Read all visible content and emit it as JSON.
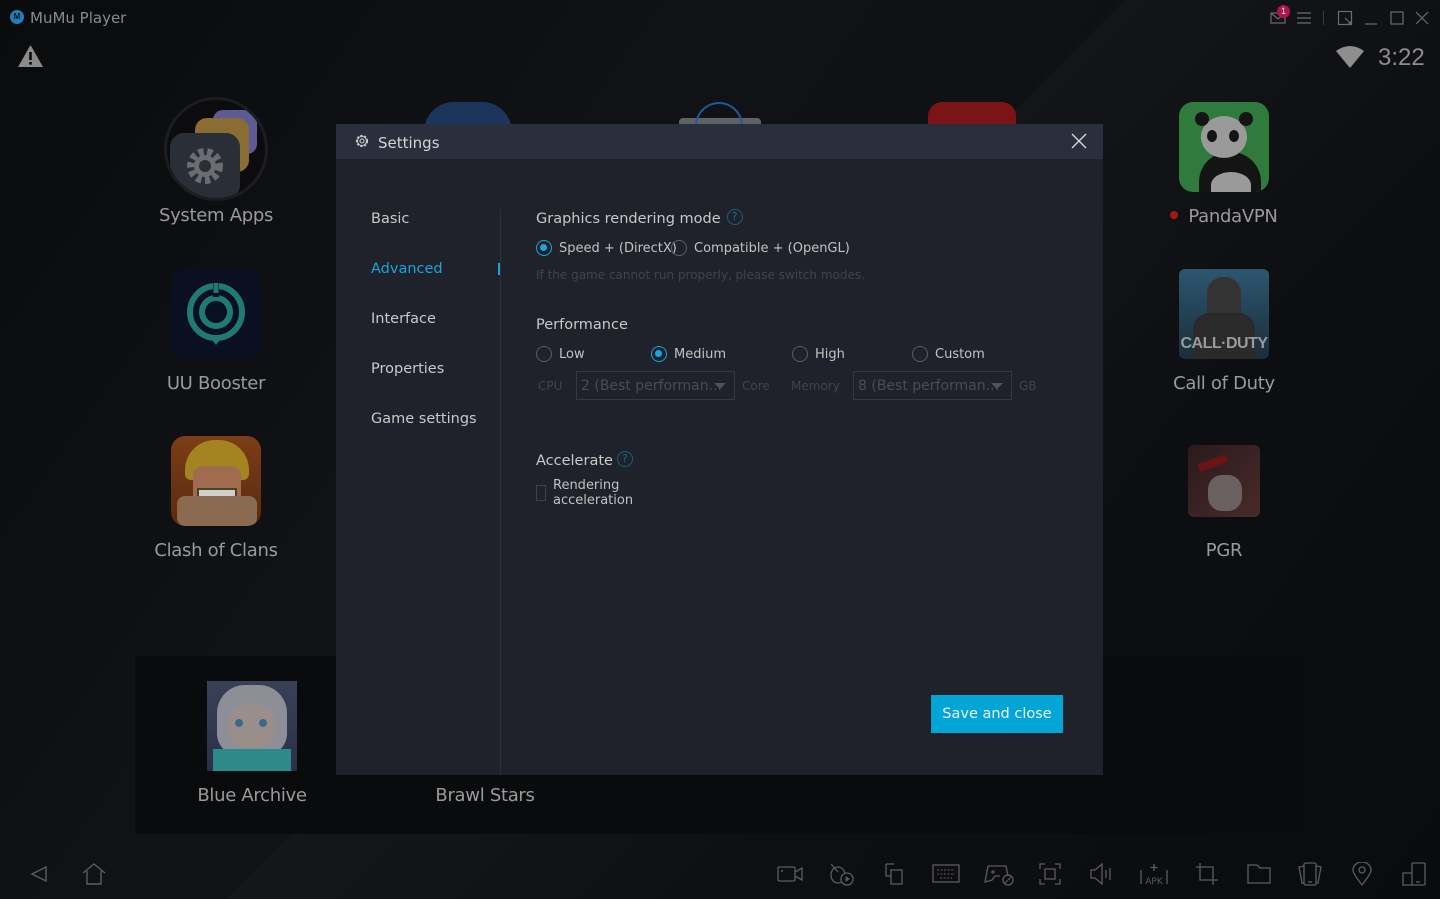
{
  "window": {
    "title": "MuMu Player",
    "notification_count": "1",
    "controls": [
      "mail-icon",
      "menu-icon",
      "resize-icon",
      "minimize-icon",
      "maximize-icon",
      "close-icon"
    ]
  },
  "statusbar": {
    "time": "3:22",
    "icons": [
      "warning-icon",
      "wifi-icon"
    ]
  },
  "desktop": {
    "apps_left": [
      {
        "label": "System Apps"
      },
      {
        "label": "UU Booster"
      },
      {
        "label": "Clash of Clans"
      }
    ],
    "apps_right": [
      {
        "label": "PandaVPN",
        "new_indicator": true
      },
      {
        "label": "Call of Duty"
      },
      {
        "label": "PGR"
      }
    ],
    "dock_apps": [
      {
        "label": "Blue Archive"
      },
      {
        "label": "Brawl Stars"
      }
    ]
  },
  "settings": {
    "title": "Settings",
    "nav": [
      {
        "label": "Basic",
        "active": false
      },
      {
        "label": "Advanced",
        "active": true
      },
      {
        "label": "Interface",
        "active": false
      },
      {
        "label": "Properties",
        "active": false
      },
      {
        "label": "Game settings",
        "active": false
      }
    ],
    "graphics": {
      "title": "Graphics rendering mode",
      "help": "?",
      "options": [
        {
          "label": "Speed + (DirectX)",
          "checked": true
        },
        {
          "label": "Compatible + (OpenGL)",
          "checked": false
        }
      ],
      "hint": "If the game cannot run properly, please switch modes."
    },
    "performance": {
      "title": "Performance",
      "options": [
        {
          "label": "Low",
          "checked": false
        },
        {
          "label": "Medium",
          "checked": true
        },
        {
          "label": "High",
          "checked": false
        },
        {
          "label": "Custom",
          "checked": false
        }
      ],
      "cpu_label": "CPU",
      "cpu_value": "2 (Best performan...",
      "cpu_unit": "Core",
      "memory_label": "Memory",
      "memory_value": "8 (Best performan...",
      "memory_unit": "GB"
    },
    "accelerate": {
      "title": "Accelerate",
      "help": "?",
      "checkbox_label": "Rendering acceleration",
      "checked": false
    },
    "save_label": "Save and close"
  },
  "bottombar": {
    "left": [
      "back-icon",
      "home-icon"
    ],
    "right": [
      "video-record-icon",
      "operation-record-icon",
      "multi-instance-icon",
      "keyboard-icon",
      "gamepad-icon",
      "screenshot-icon",
      "volume-icon",
      "install-apk-icon",
      "crop-icon",
      "folder-icon",
      "shake-icon",
      "location-icon",
      "rotate-icon"
    ]
  }
}
